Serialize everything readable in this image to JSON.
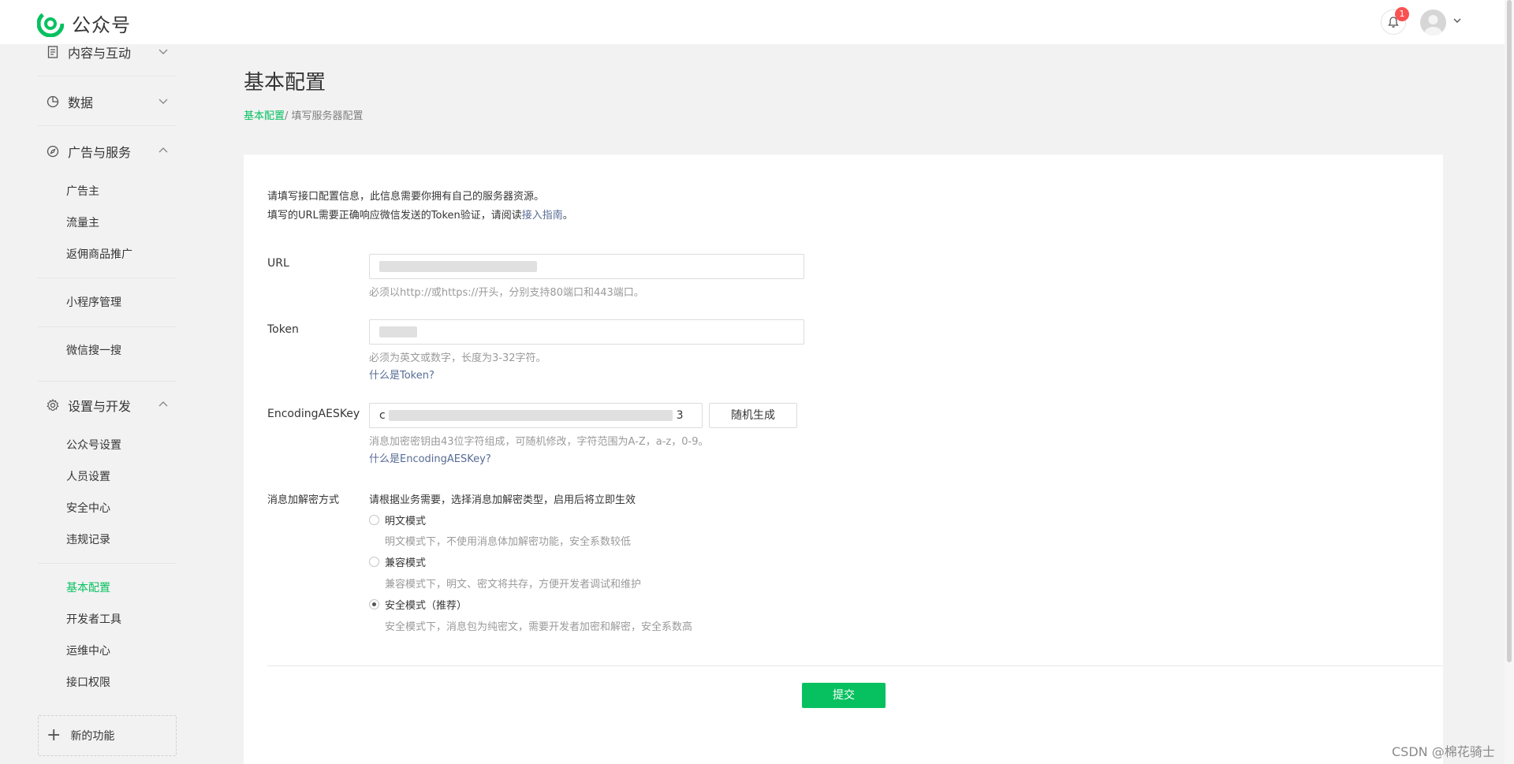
{
  "brand": {
    "app_name": "公众号"
  },
  "header": {
    "notification_count": "1"
  },
  "sidebar": {
    "groups": [
      {
        "label": "内容与互动",
        "icon": "document-icon",
        "expanded": false
      },
      {
        "label": "数据",
        "icon": "pie-chart-icon",
        "expanded": false
      },
      {
        "label": "广告与服务",
        "icon": "compass-icon",
        "expanded": true,
        "items": [
          "广告主",
          "流量主",
          "返佣商品推广",
          "小程序管理",
          "微信搜一搜"
        ]
      },
      {
        "label": "设置与开发",
        "icon": "gear-icon",
        "expanded": true,
        "items": [
          "公众号设置",
          "人员设置",
          "安全中心",
          "违规记录",
          "基本配置",
          "开发者工具",
          "运维中心",
          "接口权限"
        ]
      }
    ],
    "active_item": "基本配置",
    "new_feature": "新的功能"
  },
  "page": {
    "title": "基本配置",
    "breadcrumb": {
      "active": "基本配置",
      "separator": "/ ",
      "current": "填写服务器配置"
    }
  },
  "form": {
    "intro_line1": "请填写接口配置信息，此信息需要你拥有自己的服务器资源。",
    "intro_line2_prefix": "填写的URL需要正确响应微信发送的Token验证，请阅读",
    "intro_link": "接入指南",
    "intro_line2_suffix": "。",
    "url": {
      "label": "URL",
      "hint": "必须以http://或https://开头，分别支持80端口和443端口。"
    },
    "token": {
      "label": "Token",
      "hint": "必须为英文或数字，长度为3-32字符。",
      "help_link": "什么是Token?"
    },
    "aes": {
      "label": "EncodingAESKey",
      "value_prefix": "c",
      "value_suffix": "3",
      "random_button": "随机生成",
      "hint": "消息加密密钥由43位字符组成，可随机修改，字符范围为A-Z，a-z，0-9。",
      "help_link": "什么是EncodingAESKey?"
    },
    "encryption": {
      "label": "消息加解密方式",
      "instruction": "请根据业务需要，选择消息加解密类型，启用后将立即生效",
      "options": [
        {
          "label": "明文模式",
          "desc": "明文模式下，不使用消息体加解密功能，安全系数较低",
          "checked": false
        },
        {
          "label": "兼容模式",
          "desc": "兼容模式下，明文、密文将共存，方便开发者调试和维护",
          "checked": false
        },
        {
          "label": "安全模式（推荐）",
          "desc": "安全模式下，消息包为纯密文，需要开发者加密和解密，安全系数高",
          "checked": true
        }
      ]
    },
    "submit": "提交"
  },
  "watermark": "CSDN @棉花骑士",
  "colors": {
    "accent": "#07c160",
    "link": "#576b95",
    "badge": "#fa5151"
  }
}
